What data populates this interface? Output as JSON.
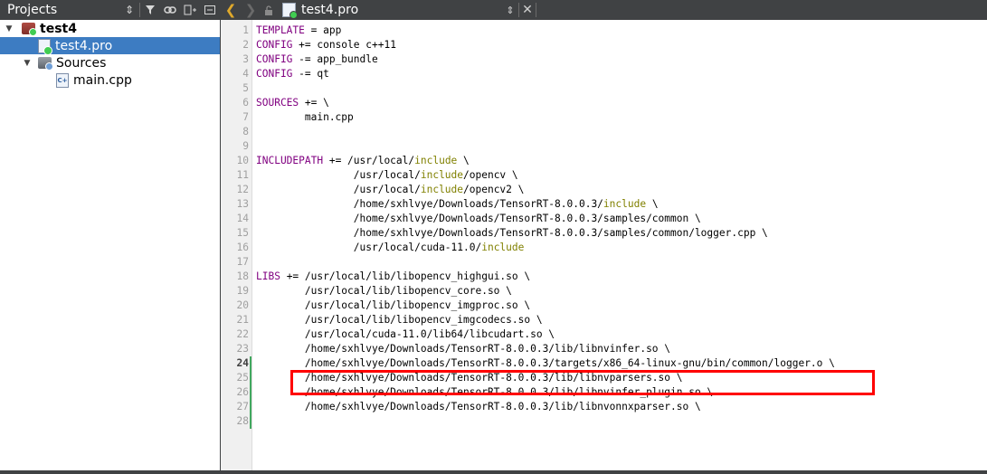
{
  "projects_pane": {
    "title": "Projects",
    "tree": [
      {
        "label": "test4",
        "level": 0,
        "type": "project",
        "expanded": true
      },
      {
        "label": "test4.pro",
        "level": 1,
        "type": "pro-file",
        "selected": true
      },
      {
        "label": "Sources",
        "level": 1,
        "type": "folder",
        "expanded": true
      },
      {
        "label": "main.cpp",
        "level": 2,
        "type": "cpp-file"
      }
    ]
  },
  "editor_tab": {
    "filename": "test4.pro"
  },
  "editor": {
    "current_line": 24,
    "lines": [
      {
        "n": "1",
        "parts": [
          [
            "kw",
            "TEMPLATE"
          ],
          [
            "",
            "= app"
          ]
        ]
      },
      {
        "n": "2",
        "parts": [
          [
            "kw",
            "CONFIG"
          ],
          [
            "",
            " += console c++11"
          ]
        ]
      },
      {
        "n": "3",
        "parts": [
          [
            "kw",
            "CONFIG"
          ],
          [
            "",
            " -= app_bundle"
          ]
        ]
      },
      {
        "n": "4",
        "parts": [
          [
            "kw",
            "CONFIG"
          ],
          [
            "",
            " -= qt"
          ]
        ]
      },
      {
        "n": "5",
        "parts": []
      },
      {
        "n": "6",
        "parts": [
          [
            "kw",
            "SOURCES"
          ],
          [
            "",
            " += \\"
          ]
        ]
      },
      {
        "n": "7",
        "parts": [
          [
            "",
            "        main.cpp"
          ]
        ]
      },
      {
        "n": "8",
        "parts": []
      },
      {
        "n": "9",
        "parts": []
      },
      {
        "n": "10",
        "parts": [
          [
            "kw",
            "INCLUDEPATH"
          ],
          [
            "",
            " += /usr/local/"
          ],
          [
            "kw2",
            "include"
          ],
          [
            "",
            " \\"
          ]
        ]
      },
      {
        "n": "11",
        "parts": [
          [
            "",
            "                /usr/local/"
          ],
          [
            "kw2",
            "include"
          ],
          [
            "",
            "/opencv \\"
          ]
        ]
      },
      {
        "n": "12",
        "parts": [
          [
            "",
            "                /usr/local/"
          ],
          [
            "kw2",
            "include"
          ],
          [
            "",
            "/opencv2 \\"
          ]
        ]
      },
      {
        "n": "13",
        "parts": [
          [
            "",
            "                /home/sxhlvye/Downloads/TensorRT-8.0.0.3/"
          ],
          [
            "kw2",
            "include"
          ],
          [
            "",
            " \\"
          ]
        ]
      },
      {
        "n": "14",
        "parts": [
          [
            "",
            "                /home/sxhlvye/Downloads/TensorRT-8.0.0.3/samples/common \\"
          ]
        ]
      },
      {
        "n": "15",
        "parts": [
          [
            "",
            "                /home/sxhlvye/Downloads/TensorRT-8.0.0.3/samples/common/logger.cpp \\"
          ]
        ]
      },
      {
        "n": "16",
        "parts": [
          [
            "",
            "                /usr/local/cuda-11.0/"
          ],
          [
            "kw2",
            "include"
          ]
        ]
      },
      {
        "n": "17",
        "parts": []
      },
      {
        "n": "18",
        "parts": [
          [
            "kw",
            "LIBS"
          ],
          [
            "",
            " += /usr/local/lib/libopencv_highgui.so \\"
          ]
        ]
      },
      {
        "n": "19",
        "parts": [
          [
            "",
            "        /usr/local/lib/libopencv_core.so \\"
          ]
        ]
      },
      {
        "n": "20",
        "parts": [
          [
            "",
            "        /usr/local/lib/libopencv_imgproc.so \\"
          ]
        ]
      },
      {
        "n": "21",
        "parts": [
          [
            "",
            "        /usr/local/lib/libopencv_imgcodecs.so \\"
          ]
        ]
      },
      {
        "n": "22",
        "parts": [
          [
            "",
            "        /usr/local/cuda-11.0/lib64/libcudart.so \\"
          ]
        ]
      },
      {
        "n": "23",
        "parts": [
          [
            "",
            "        /home/sxhlvye/Downloads/TensorRT-8.0.0.3/lib/libnvinfer.so \\"
          ]
        ]
      },
      {
        "n": "24",
        "parts": [
          [
            "",
            "        /home/sxhlvye/Downloads/TensorRT-8.0.0.3/targets/x86_64-linux-gnu/bin/common/logger.o \\"
          ]
        ]
      },
      {
        "n": "25",
        "parts": [
          [
            "",
            "        /home/sxhlvye/Downloads/TensorRT-8.0.0.3/lib/libnvparsers.so \\"
          ]
        ]
      },
      {
        "n": "26",
        "parts": [
          [
            "",
            "        /home/sxhlvye/Downloads/TensorRT-8.0.0.3/lib/libnvinfer_plugin.so \\"
          ]
        ]
      },
      {
        "n": "27",
        "parts": [
          [
            "",
            "        /home/sxhlvye/Downloads/TensorRT-8.0.0.3/lib/libnvonnxparser.so \\"
          ]
        ]
      },
      {
        "n": "28",
        "parts": []
      }
    ],
    "changed_lines": [
      "24",
      "25",
      "26",
      "27",
      "28"
    ]
  },
  "colors": {
    "keyword": "#800080",
    "builtin": "#808000",
    "selection": "#3d7cc2",
    "highlight_box": "#ff0000"
  }
}
